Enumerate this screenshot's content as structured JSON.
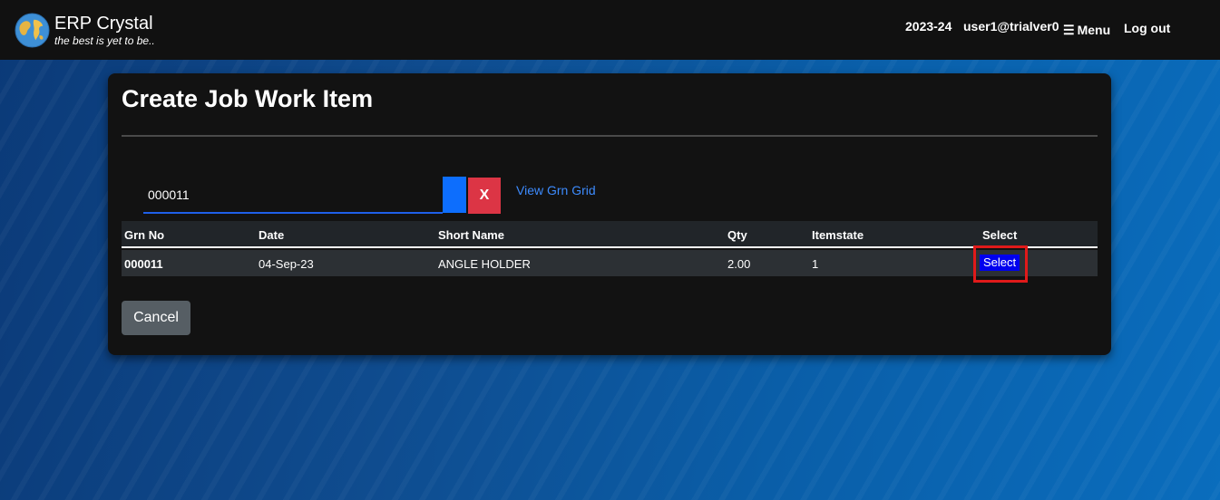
{
  "navbar": {
    "brand_name": "ERP Crystal",
    "brand_tagline": "the best is yet to be..",
    "logo_icon": "globe-icon",
    "financial_year": "2023-24",
    "user": "user1@trialver0",
    "menu_icon": "hamburger-icon",
    "menu_label": "Menu",
    "logout_label": "Log out"
  },
  "page": {
    "title": "Create Job Work Item"
  },
  "search": {
    "value": "000011",
    "clear_label": "X",
    "view_grid_link": "View Grn Grid"
  },
  "table": {
    "headers": {
      "grn_no": "Grn No",
      "date": "Date",
      "short_name": "Short Name",
      "qty": "Qty",
      "itemstate": "Itemstate",
      "select": "Select"
    },
    "rows": [
      {
        "grn_no": "000011",
        "date": "04-Sep-23",
        "short_name": "ANGLE HOLDER",
        "qty": "2.00",
        "itemstate": "1",
        "select_label": "Select"
      }
    ]
  },
  "actions": {
    "cancel_label": "Cancel"
  },
  "colors": {
    "navbar_bg": "#111111",
    "card_bg": "#121212",
    "primary": "#0d6efd",
    "danger": "#dc3545",
    "link": "#3d8bfd",
    "highlight": "#e01a1a"
  }
}
